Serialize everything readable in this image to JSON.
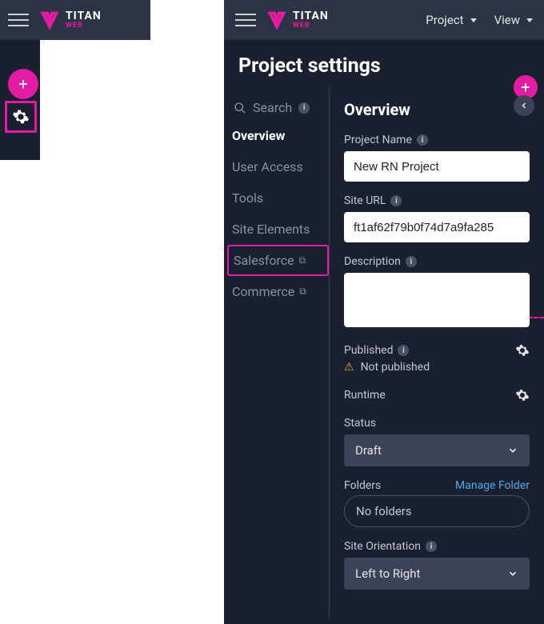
{
  "brand": {
    "title": "TITAN",
    "subtitle": "WEB"
  },
  "rightHeader": {
    "project": "Project",
    "view": "View"
  },
  "pageTitle": "Project settings",
  "nav": {
    "search": "Search",
    "items": [
      {
        "label": "Overview",
        "active": true,
        "external": false
      },
      {
        "label": "User Access",
        "active": false,
        "external": false
      },
      {
        "label": "Tools",
        "active": false,
        "external": false
      },
      {
        "label": "Site Elements",
        "active": false,
        "external": false
      },
      {
        "label": "Salesforce",
        "active": false,
        "external": true
      },
      {
        "label": "Commerce",
        "active": false,
        "external": true
      }
    ]
  },
  "overview": {
    "heading": "Overview",
    "projectName": {
      "label": "Project Name",
      "value": "New RN Project"
    },
    "siteUrl": {
      "label": "Site URL",
      "value": "ft1af62f79b0f74d7a9fa285"
    },
    "description": {
      "label": "Description",
      "value": ""
    },
    "published": {
      "label": "Published",
      "status": "Not published"
    },
    "runtime": {
      "label": "Runtime"
    },
    "status": {
      "label": "Status",
      "value": "Draft"
    },
    "folders": {
      "label": "Folders",
      "value": "No folders",
      "manage": "Manage Folder"
    },
    "orientation": {
      "label": "Site Orientation",
      "value": "Left to Right"
    }
  }
}
